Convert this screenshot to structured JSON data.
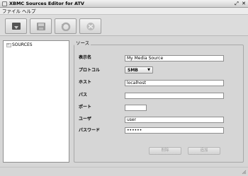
{
  "window": {
    "title": "XBMC Sources Editor for ATV",
    "restore_glyph": "⤢",
    "close_glyph": "✕"
  },
  "menubar": {
    "items": [
      {
        "label": "ファイル"
      },
      {
        "label": "ヘルプ"
      }
    ]
  },
  "toolbar": {
    "buttons": [
      {
        "icon": "download-icon"
      },
      {
        "icon": "save-icon"
      },
      {
        "icon": "undo-icon"
      },
      {
        "icon": "network-icon"
      }
    ]
  },
  "tree": {
    "root_label": "SOURCES",
    "root_icon": "folder-icon"
  },
  "form": {
    "group_title": "ソース",
    "fields": {
      "name": {
        "label": "表示名",
        "value": "My Media Source"
      },
      "protocol": {
        "label": "プロトコル",
        "value": "SMB"
      },
      "host": {
        "label": "ホスト",
        "value": "localhost"
      },
      "path": {
        "label": "パス",
        "value": ""
      },
      "port": {
        "label": "ポート",
        "value": ""
      },
      "user": {
        "label": "ユーザ",
        "value": "user"
      },
      "password": {
        "label": "パスワード",
        "value": "••••••"
      }
    },
    "delete_label": "削除",
    "add_label": "追加"
  }
}
